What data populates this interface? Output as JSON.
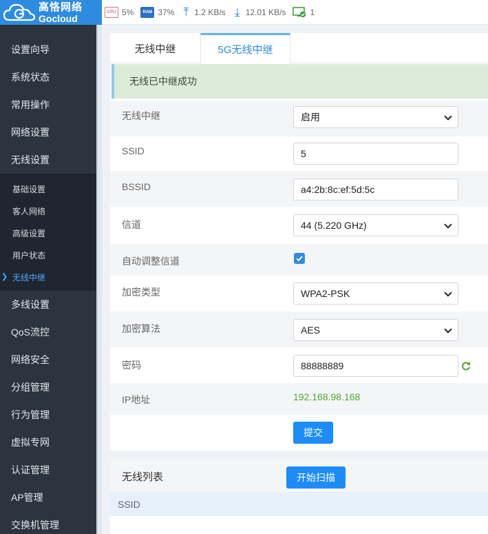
{
  "brand": {
    "name_cn": "高恪网络",
    "name_en": "Gocloud"
  },
  "status": {
    "cpu_label": "CPU",
    "cpu": "5%",
    "ram_label": "RAM",
    "ram": "37%",
    "upload": "1.2 KB/s",
    "download": "12.01 KB/s",
    "connections": "1"
  },
  "sidebar": {
    "items": [
      {
        "label": "设置向导"
      },
      {
        "label": "系统状态"
      },
      {
        "label": "常用操作"
      },
      {
        "label": "网络设置"
      },
      {
        "label": "无线设置"
      }
    ],
    "sub_items": [
      {
        "label": "基础设置"
      },
      {
        "label": "客人网络"
      },
      {
        "label": "高级设置"
      },
      {
        "label": "用户状态"
      },
      {
        "label": "无线中继"
      }
    ],
    "items_after": [
      {
        "label": "多线设置"
      },
      {
        "label": "QoS流控"
      },
      {
        "label": "网络安全"
      },
      {
        "label": "分组管理"
      },
      {
        "label": "行为管理"
      },
      {
        "label": "虚拟专网"
      },
      {
        "label": "认证管理"
      },
      {
        "label": "AP管理"
      },
      {
        "label": "交换机管理"
      }
    ]
  },
  "tabs": [
    {
      "label": "无线中继"
    },
    {
      "label": "5G无线中继"
    }
  ],
  "alert": "无线已中继成功",
  "form": {
    "repeater": {
      "label": "无线中继",
      "value": "启用"
    },
    "ssid": {
      "label": "SSID",
      "value": "5"
    },
    "bssid": {
      "label": "BSSID",
      "value": "a4:2b:8c:ef:5d:5c"
    },
    "channel": {
      "label": "信道",
      "value": "44 (5.220 GHz)"
    },
    "auto_channel": {
      "label": "自动调整信道"
    },
    "encryption": {
      "label": "加密类型",
      "value": "WPA2-PSK"
    },
    "cipher": {
      "label": "加密算法",
      "value": "AES"
    },
    "password": {
      "label": "密码",
      "value": "88888889"
    },
    "ip": {
      "label": "IP地址",
      "value": "192.168.98.168"
    },
    "submit": "提交"
  },
  "wireless_list": {
    "title": "无线列表",
    "scan_button": "开始扫描",
    "column_ssid": "SSID"
  },
  "colors": {
    "accent": "#2e8ce0",
    "sidebar_bg": "#2c3440",
    "success_bg": "#dcecd8",
    "ip_green": "#4ea82f"
  }
}
